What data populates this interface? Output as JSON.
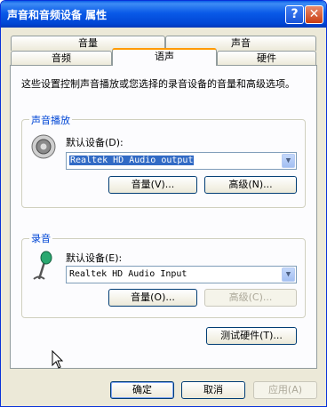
{
  "window": {
    "title": "声音和音频设备 属性",
    "help_glyph": "?",
    "close_glyph": "✕"
  },
  "tabs": {
    "row1": [
      "音量",
      "声音"
    ],
    "row2": [
      "音频",
      "语声",
      "硬件"
    ],
    "active": "语声"
  },
  "description": "这些设置控制声音播放或您选择的录音设备的音量和高级选项。",
  "playback": {
    "group_title": "声音播放",
    "device_label": "默认设备(D):",
    "device_value": "Realtek HD Audio output",
    "volume_button": "音量(V)...",
    "advanced_button": "高级(N)..."
  },
  "recording": {
    "group_title": "录音",
    "device_label": "默认设备(E):",
    "device_value": "Realtek HD Audio Input",
    "volume_button": "音量(O)...",
    "advanced_button": "高级(C)..."
  },
  "test_button": "测试硬件(T)...",
  "footer": {
    "ok": "确定",
    "cancel": "取消",
    "apply": "应用(A)"
  },
  "icons": {
    "dropdown": "▼",
    "speaker": "speaker-icon",
    "microphone": "microphone-icon",
    "cursor": "cursor-icon"
  }
}
